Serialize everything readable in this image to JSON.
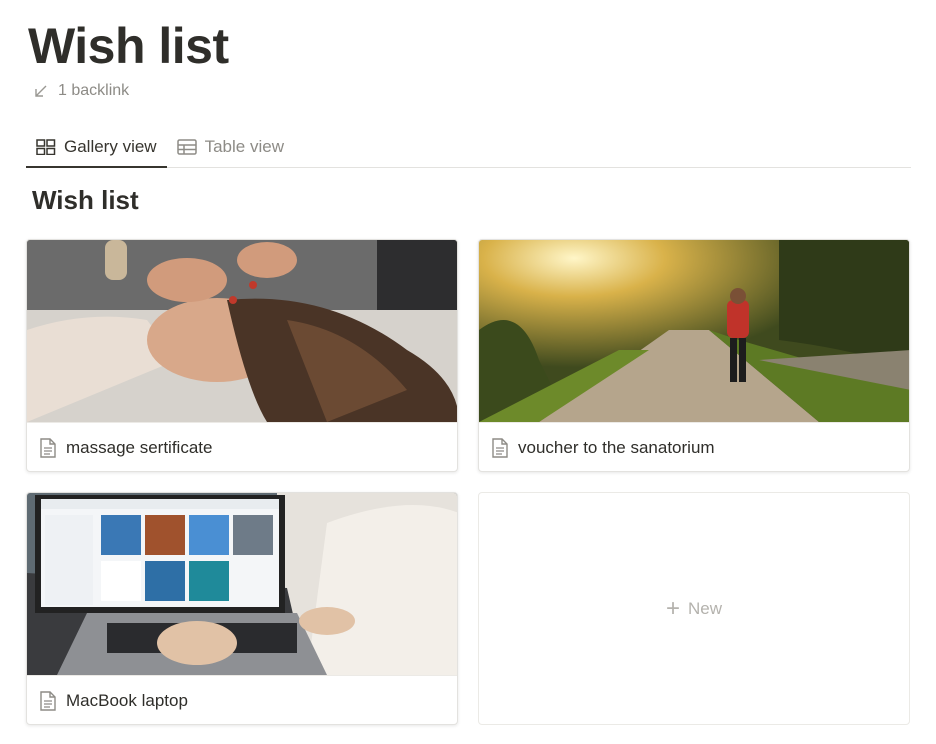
{
  "page": {
    "title": "Wish list",
    "backlink": "1 backlink"
  },
  "tabs": [
    {
      "label": "Gallery view",
      "icon": "gallery-icon",
      "active": true
    },
    {
      "label": "Table view",
      "icon": "table-icon",
      "active": false
    }
  ],
  "gallery": {
    "title": "Wish list",
    "cards": [
      {
        "title": "massage sertificate",
        "icon": "page-icon",
        "cover": "woman receiving face massage"
      },
      {
        "title": "voucher to the sanatorium",
        "icon": "page-icon",
        "cover": "woman walking on sunlit country road"
      },
      {
        "title": "MacBook laptop",
        "icon": "page-icon",
        "cover": "laptop with website on screen"
      }
    ],
    "new_label": "New"
  },
  "colors": {
    "text": "#37352f",
    "muted": "#8d8b86",
    "border": "#e3e2df"
  }
}
